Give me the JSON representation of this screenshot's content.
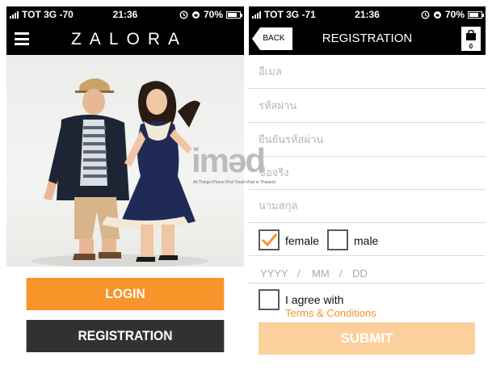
{
  "left_screen": {
    "status": {
      "carrier": "TOT 3G -70",
      "time": "21:36",
      "battery": "70%",
      "battery_level": 0.7
    },
    "brand": "ZALORA",
    "login_label": "LOGIN",
    "registration_label": "REGISTRATION"
  },
  "right_screen": {
    "status": {
      "carrier": "TOT 3G -71",
      "time": "21:36",
      "battery": "70%",
      "battery_level": 0.7
    },
    "back_label": "BACK",
    "title": "REGISTRATION",
    "cart_count": "0",
    "fields": {
      "email_placeholder": "อีเมล",
      "password_placeholder": "รหัสผ่าน",
      "confirm_password_placeholder": "ยืนยันรหัสผ่าน",
      "first_name_placeholder": "ชื่อจริง",
      "last_name_placeholder": "นามสกุล"
    },
    "gender": {
      "female_label": "female",
      "male_label": "male",
      "female_checked": true,
      "male_checked": false
    },
    "birthdate": {
      "year": "YYYY",
      "sep1": "/",
      "month": "MM",
      "sep2": "/",
      "day": "DD"
    },
    "agree_label": "I agree with",
    "terms_label": "Terms & Conditions",
    "agree_checked": false,
    "submit_label": "SUBMIT"
  },
  "watermark": {
    "brand": "iməd",
    "tagline": "All Things iPhone iPod Touch iPad in Thailand"
  },
  "colors": {
    "accent": "#f7942a",
    "dark_button": "#313131",
    "submit_disabled": "#fcd09d",
    "bar": "#000000"
  },
  "icons": [
    "menu-icon",
    "alarm-icon",
    "lock-rotation-icon",
    "battery-icon",
    "shopping-bag-icon",
    "checkmark-icon"
  ]
}
